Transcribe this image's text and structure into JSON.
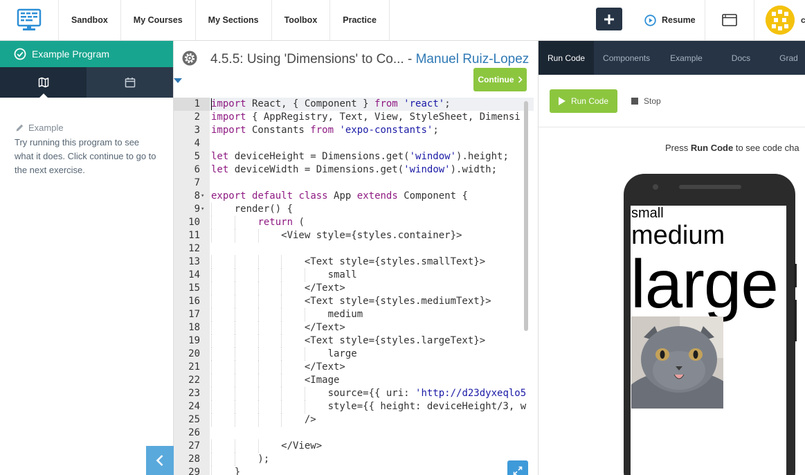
{
  "nav": {
    "links": [
      "Sandbox",
      "My Courses",
      "My Sections",
      "Toolbox",
      "Practice"
    ],
    "resume_label": "Resume",
    "plus_label": "+",
    "user_initial": "c"
  },
  "sidebar": {
    "program_label": "Example Program",
    "example_label": "Example",
    "example_text": "Try running this program to see what it does. Click continue to go to the next exercise."
  },
  "editor": {
    "title": "4.5.5: Using 'Dimensions' to Co...",
    "title_sep": " - ",
    "author": "Manuel Ruiz-Lopez",
    "continue_label": "Continue"
  },
  "code": [
    {
      "n": "1",
      "fold": "",
      "html": "<span class=\"kw\">import</span> React, { Component } <span class=\"kw\">from</span> <span class=\"str\">'react'</span>;"
    },
    {
      "n": "2",
      "fold": "",
      "html": "<span class=\"kw\">import</span> { AppRegistry, Text, View, StyleSheet, Dimensi"
    },
    {
      "n": "3",
      "fold": "",
      "html": "<span class=\"kw\">import</span> Constants <span class=\"kw\">from</span> <span class=\"str\">'expo-constants'</span>;"
    },
    {
      "n": "4",
      "fold": "",
      "html": ""
    },
    {
      "n": "5",
      "fold": "",
      "html": "<span class=\"kw\">let</span> deviceHeight = Dimensions.get(<span class=\"str\">'window'</span>).height;"
    },
    {
      "n": "6",
      "fold": "",
      "html": "<span class=\"kw\">let</span> deviceWidth = Dimensions.get(<span class=\"str\">'window'</span>).width;"
    },
    {
      "n": "7",
      "fold": "",
      "html": ""
    },
    {
      "n": "8",
      "fold": "▾",
      "html": "<span class=\"kw\">export</span> <span class=\"kw\">default</span> <span class=\"kw\">class</span> App <span class=\"kw\">extends</span> Component {"
    },
    {
      "n": "9",
      "fold": "▾",
      "html": "    render() {"
    },
    {
      "n": "10",
      "fold": "",
      "html": "        <span class=\"kw\">return</span> ("
    },
    {
      "n": "11",
      "fold": "",
      "html": "            &lt;View style={styles.container}&gt;"
    },
    {
      "n": "12",
      "fold": "",
      "html": ""
    },
    {
      "n": "13",
      "fold": "",
      "html": "                &lt;Text style={styles.smallText}&gt;"
    },
    {
      "n": "14",
      "fold": "",
      "html": "                    small"
    },
    {
      "n": "15",
      "fold": "",
      "html": "                &lt;/Text&gt;"
    },
    {
      "n": "16",
      "fold": "",
      "html": "                &lt;Text style={styles.mediumText}&gt;"
    },
    {
      "n": "17",
      "fold": "",
      "html": "                    medium"
    },
    {
      "n": "18",
      "fold": "",
      "html": "                &lt;/Text&gt;"
    },
    {
      "n": "19",
      "fold": "",
      "html": "                &lt;Text style={styles.largeText}&gt;"
    },
    {
      "n": "20",
      "fold": "",
      "html": "                    large"
    },
    {
      "n": "21",
      "fold": "",
      "html": "                &lt;/Text&gt;"
    },
    {
      "n": "22",
      "fold": "",
      "html": "                &lt;Image"
    },
    {
      "n": "23",
      "fold": "",
      "html": "                    source={{ uri: <span class=\"str\">'http://d23dyxeqlo5</span>"
    },
    {
      "n": "24",
      "fold": "",
      "html": "                    style={{ height: deviceHeight/3, w"
    },
    {
      "n": "25",
      "fold": "",
      "html": "                /&gt;"
    },
    {
      "n": "26",
      "fold": "",
      "html": ""
    },
    {
      "n": "27",
      "fold": "",
      "html": "            &lt;/View&gt;"
    },
    {
      "n": "28",
      "fold": "",
      "html": "        );"
    },
    {
      "n": "29",
      "fold": "",
      "html": "    }"
    }
  ],
  "right": {
    "tabs": [
      "Run Code",
      "Components",
      "Example",
      "Docs",
      "Grad"
    ],
    "run_label": "Run Code",
    "stop_label": "Stop",
    "hint_prefix": "Press ",
    "hint_bold": "Run Code",
    "hint_suffix": " to see code cha"
  },
  "phone": {
    "small": "small",
    "medium": "medium",
    "large": "large"
  },
  "colors": {
    "accent_green": "#8cc63f",
    "teal": "#18a58f",
    "navy": "#263445",
    "link_blue": "#2f79b5"
  }
}
